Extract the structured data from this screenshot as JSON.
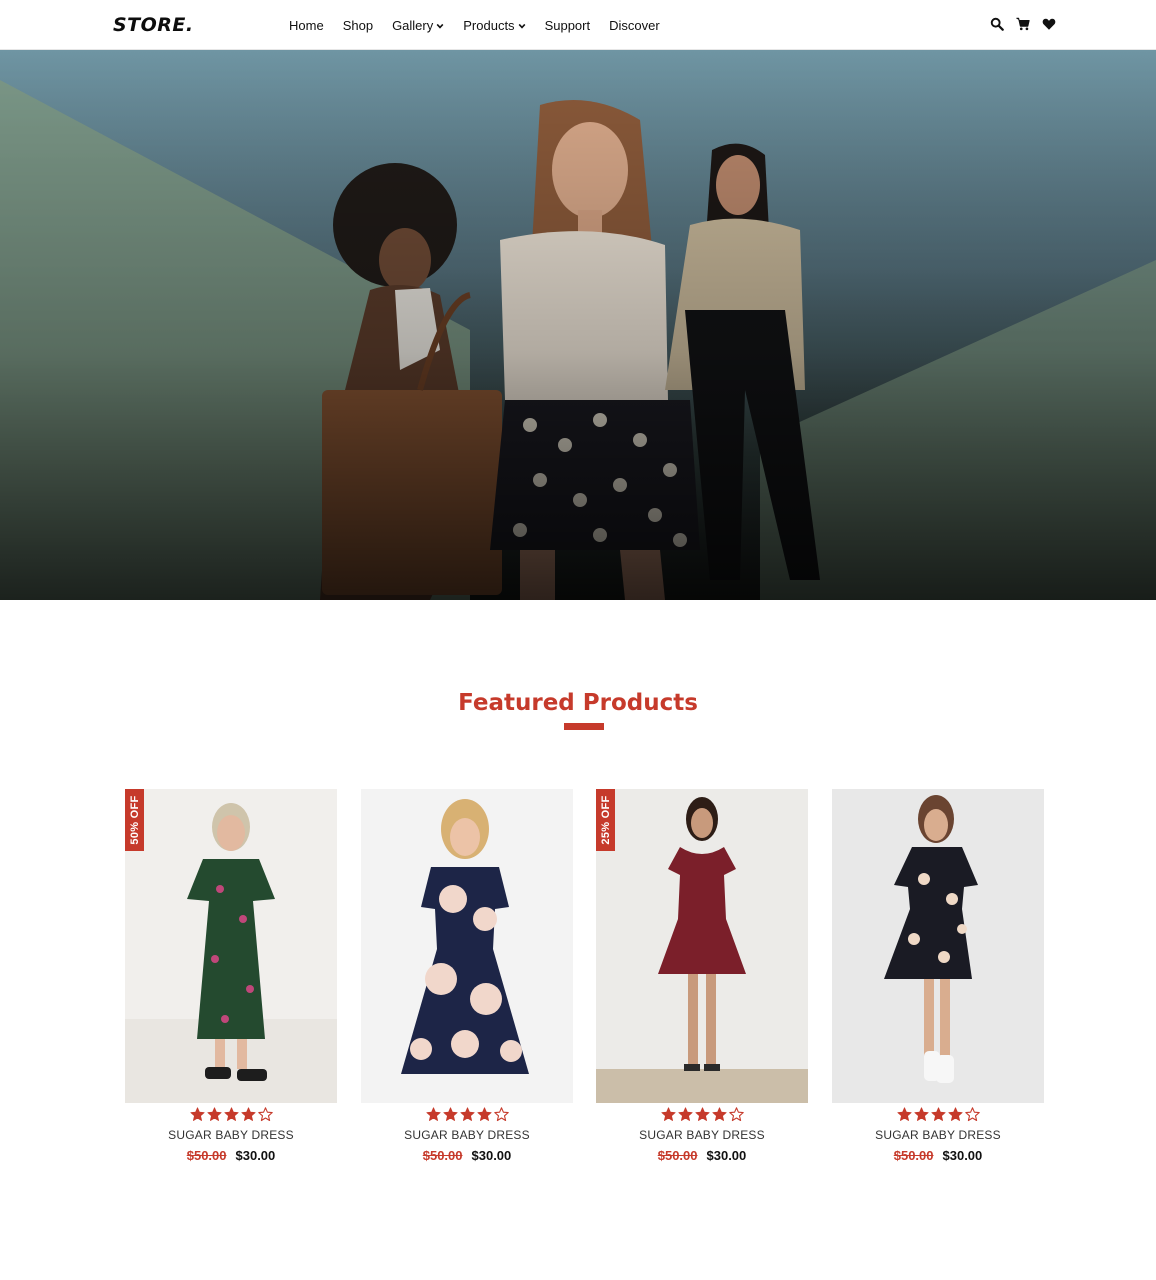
{
  "brand": {
    "logo": "STORE."
  },
  "nav": {
    "items": [
      {
        "label": "Home",
        "dropdown": false
      },
      {
        "label": "Shop",
        "dropdown": false
      },
      {
        "label": "Gallery",
        "dropdown": true
      },
      {
        "label": "Products",
        "dropdown": true
      },
      {
        "label": "Support",
        "dropdown": false
      },
      {
        "label": "Discover",
        "dropdown": false
      }
    ],
    "icons": [
      "search-icon",
      "cart-icon",
      "heart-icon"
    ]
  },
  "colors": {
    "accent": "#c63a2b",
    "text": "#111111"
  },
  "featured": {
    "title": "Featured Products",
    "products": [
      {
        "badge": "50% OFF",
        "name": "SUGAR BABY DRESS",
        "old_price": "$50.00",
        "price": "$30.00",
        "rating": 4,
        "max_rating": 5
      },
      {
        "badge": "",
        "name": "SUGAR BABY DRESS",
        "old_price": "$50.00",
        "price": "$30.00",
        "rating": 4,
        "max_rating": 5
      },
      {
        "badge": "25% OFF",
        "name": "SUGAR BABY DRESS",
        "old_price": "$50.00",
        "price": "$30.00",
        "rating": 4,
        "max_rating": 5
      },
      {
        "badge": "",
        "name": "SUGAR BABY DRESS",
        "old_price": "$50.00",
        "price": "$30.00",
        "rating": 4,
        "max_rating": 5
      }
    ]
  }
}
